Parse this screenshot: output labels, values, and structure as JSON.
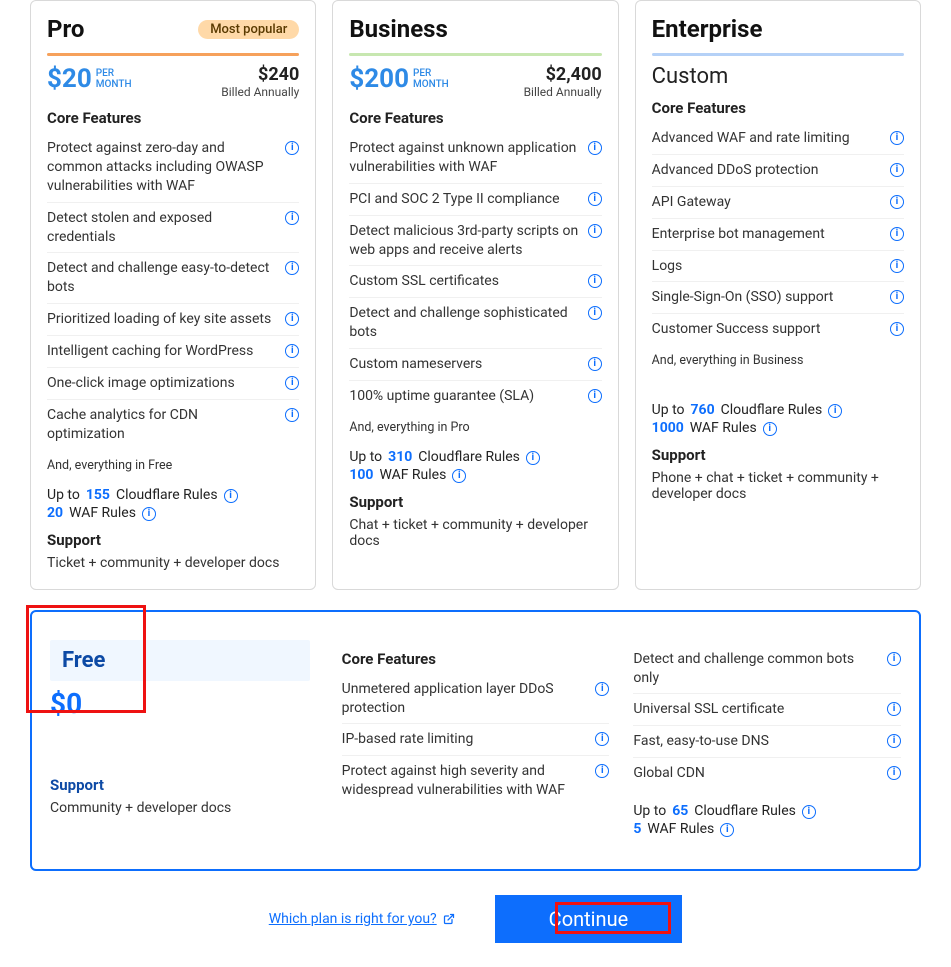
{
  "common": {
    "per_month": "PER\nMONTH",
    "billed_annually": "Billed Annually",
    "core_features": "Core Features",
    "support": "Support",
    "cf_rules_prefix": "Up to",
    "cf_rules_label": "Cloudflare Rules",
    "waf_rules_label": "WAF Rules"
  },
  "plans": {
    "pro": {
      "name": "Pro",
      "badge": "Most popular",
      "price": "$20",
      "annual_price": "$240",
      "features": [
        "Protect against zero-day and common attacks including OWASP vulnerabilities with WAF",
        "Detect stolen and exposed credentials",
        "Detect and challenge easy-to-detect bots",
        "Prioritized loading of key site assets",
        "Intelligent caching for WordPress",
        "One-click image optimizations",
        "Cache analytics for CDN optimization"
      ],
      "everything": "And, everything in Free",
      "cf_rules": "155",
      "waf_rules": "20",
      "support": "Ticket + community + developer docs"
    },
    "business": {
      "name": "Business",
      "price": "$200",
      "annual_price": "$2,400",
      "features": [
        "Protect against unknown application vulnerabilities with WAF",
        "PCI and SOC 2 Type II compliance",
        "Detect malicious 3rd-party scripts on web apps and receive alerts",
        "Custom SSL certificates",
        "Detect and challenge sophisticated bots",
        "Custom nameservers",
        "100% uptime guarantee (SLA)"
      ],
      "everything": "And, everything in Pro",
      "cf_rules": "310",
      "waf_rules": "100",
      "support": "Chat + ticket + community + developer docs"
    },
    "enterprise": {
      "name": "Enterprise",
      "custom": "Custom",
      "features": [
        "Advanced WAF and rate limiting",
        "Advanced DDoS protection",
        "API Gateway",
        "Enterprise bot management",
        "Logs",
        "Single-Sign-On (SSO) support",
        "Customer Success support"
      ],
      "everything": "And, everything in Business",
      "cf_rules": "760",
      "waf_rules": "1000",
      "support": "Phone + chat + ticket + community + developer docs"
    }
  },
  "free": {
    "name": "Free",
    "price": "$0",
    "features_left": [
      "Unmetered application layer DDoS protection",
      "IP-based rate limiting",
      "Protect against high severity and widespread vulnerabilities with WAF"
    ],
    "features_right": [
      "Detect and challenge common bots only",
      "Universal SSL certificate",
      "Fast, easy-to-use DNS",
      "Global CDN"
    ],
    "cf_rules": "65",
    "waf_rules": "5",
    "support": "Community + developer docs"
  },
  "footer": {
    "help_text": "Which plan is right for you?",
    "continue": "Continue"
  }
}
